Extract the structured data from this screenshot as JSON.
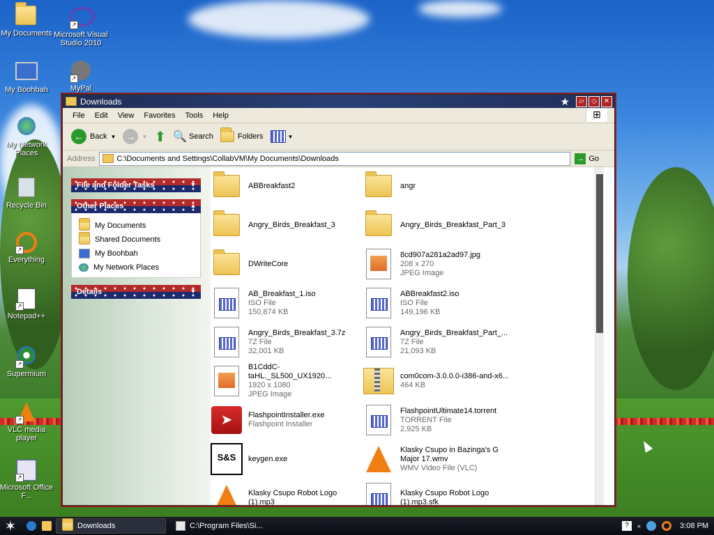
{
  "desktop": {
    "icons": [
      {
        "label": "My Documents"
      },
      {
        "label": "Microsoft Visual Studio 2010"
      },
      {
        "label": "My Boohbah"
      },
      {
        "label": "MyPal"
      },
      {
        "label": "My Network Places"
      },
      {
        "label": "Recycle Bin"
      },
      {
        "label": "Everything"
      },
      {
        "label": "Notepad++"
      },
      {
        "label": "Supermium"
      },
      {
        "label": "VLC media player"
      },
      {
        "label": "Microsoft Office F..."
      }
    ]
  },
  "window": {
    "title": "Downloads",
    "menu": [
      "File",
      "Edit",
      "View",
      "Favorites",
      "Tools",
      "Help"
    ],
    "toolbar": {
      "back": "Back",
      "search": "Search",
      "folders": "Folders"
    },
    "address": {
      "label": "Address",
      "value": "C:\\Documents and Settings\\CollabVM\\My Documents\\Downloads",
      "go": "Go"
    },
    "left_pane": {
      "file_tasks": "File and Folder Tasks",
      "other_places": "Other Places",
      "other_links": [
        "My Documents",
        "Shared Documents",
        "My Boohbah",
        "My Network Places"
      ],
      "details": "Details"
    },
    "files": [
      {
        "name": "ABBreakfast2",
        "line2": "",
        "line3": ""
      },
      {
        "name": "angr",
        "line2": "",
        "line3": ""
      },
      {
        "name": "Angry_Birds_Breakfast_3",
        "line2": "",
        "line3": ""
      },
      {
        "name": "Angry_Birds_Breakfast_Part_3",
        "line2": "",
        "line3": ""
      },
      {
        "name": "DWriteCore",
        "line2": "",
        "line3": ""
      },
      {
        "name": "8cd907a281a2ad97.jpg",
        "line2": "208 x 270",
        "line3": "JPEG Image"
      },
      {
        "name": "AB_Breakfast_1.iso",
        "line2": "ISO File",
        "line3": "150,874 KB"
      },
      {
        "name": "ABBreakfast2.iso",
        "line2": "ISO File",
        "line3": "149,196 KB"
      },
      {
        "name": "Angry_Birds_Breakfast_3.7z",
        "line2": "7Z File",
        "line3": "32,001 KB"
      },
      {
        "name": "Angry_Birds_Breakfast_Part_...",
        "line2": "7Z File",
        "line3": "21,093 KB"
      },
      {
        "name": "B1CddC-taHL._SL500_UX1920...",
        "line2": "1920 x 1080",
        "line3": "JPEG Image"
      },
      {
        "name": "com0com-3.0.0.0-i386-and-x6...",
        "line2": "464 KB",
        "line3": ""
      },
      {
        "name": "FlashpointInstaller.exe",
        "line2": "Flashpoint Installer",
        "line3": ""
      },
      {
        "name": "FlashpointUltimate14.torrent",
        "line2": "TORRENT File",
        "line3": "2,925 KB"
      },
      {
        "name": "keygen.exe",
        "line2": "",
        "line3": ""
      },
      {
        "name": "Klasky Csupo in Bazinga's G",
        "line2": "Major 17.wmv",
        "line3": "WMV Video File (VLC)"
      },
      {
        "name": "Klasky Csupo Robot Logo",
        "line2": "(1).mp3",
        "line3": ""
      },
      {
        "name": "Klasky Csupo Robot Logo",
        "line2": "(1).mp3.sfk",
        "line3": ""
      }
    ]
  },
  "taskbar": {
    "tasks": [
      "Downloads",
      "C:\\Program Files\\Si..."
    ],
    "clock": "3:08 PM"
  },
  "colors": {
    "title_bar": "#1e2d55",
    "frame": "#8a1c1c",
    "taskbar": "#0b0d14"
  }
}
